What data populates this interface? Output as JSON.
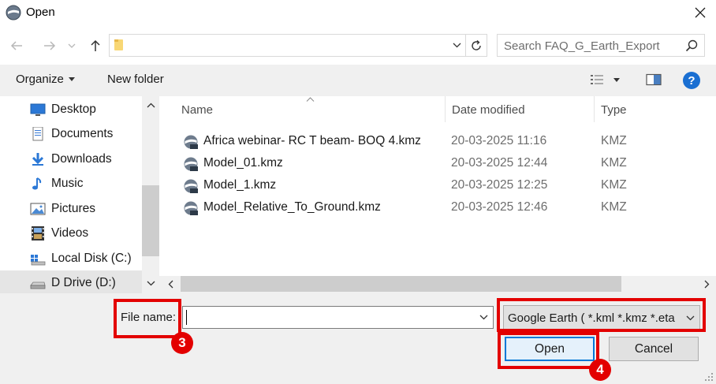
{
  "window": {
    "title": "Open",
    "icon": "google-earth-icon"
  },
  "address_bar": {
    "path": ""
  },
  "search": {
    "placeholder": "Search FAQ_G_Earth_Export"
  },
  "toolbar": {
    "organize_label": "Organize",
    "new_folder_label": "New folder",
    "help_label": "?"
  },
  "nav": {
    "items": [
      {
        "label": "Desktop",
        "icon": "desktop-icon"
      },
      {
        "label": "Documents",
        "icon": "documents-icon"
      },
      {
        "label": "Downloads",
        "icon": "downloads-icon"
      },
      {
        "label": "Music",
        "icon": "music-icon"
      },
      {
        "label": "Pictures",
        "icon": "pictures-icon"
      },
      {
        "label": "Videos",
        "icon": "videos-icon"
      },
      {
        "label": "Local Disk (C:)",
        "icon": "local-disk-icon"
      },
      {
        "label": "D Drive (D:)",
        "icon": "drive-icon",
        "selected": true
      }
    ]
  },
  "filelist": {
    "columns": {
      "name": "Name",
      "date": "Date modified",
      "type": "Type"
    },
    "files": [
      {
        "name": "Africa webinar- RC T beam- BOQ 4.kmz",
        "date": "20-03-2025 11:16",
        "type": "KMZ"
      },
      {
        "name": "Model_01.kmz",
        "date": "20-03-2025 12:44",
        "type": "KMZ"
      },
      {
        "name": "Model_1.kmz",
        "date": "20-03-2025 12:25",
        "type": "KMZ"
      },
      {
        "name": "Model_Relative_To_Ground.kmz",
        "date": "20-03-2025 12:46",
        "type": "KMZ"
      }
    ]
  },
  "bottom": {
    "filename_label": "File name:",
    "filename_value": "",
    "filetype_value": "Google Earth ( *.kml *.kmz *.eta",
    "open_label": "Open",
    "cancel_label": "Cancel"
  },
  "annotations": {
    "badge_3": "3",
    "badge_4": "4",
    "color": "#e30000"
  },
  "colors": {
    "accent": "#0078d7",
    "help": "#1a6fd2",
    "chrome": "#f0f0f0"
  }
}
